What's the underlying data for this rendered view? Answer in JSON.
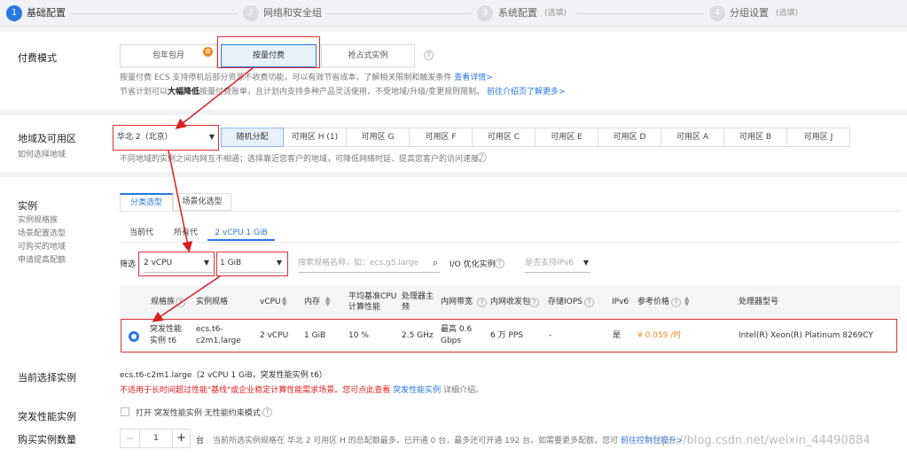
{
  "steps": [
    {
      "num": "1",
      "label": "基础配置",
      "optional": ""
    },
    {
      "num": "2",
      "label": "网络和安全组",
      "optional": ""
    },
    {
      "num": "3",
      "label": "系统配置",
      "optional": "(选填)"
    },
    {
      "num": "4",
      "label": "分组设置",
      "optional": "(选填)"
    }
  ],
  "billing": {
    "title": "付费模式",
    "options": [
      "包年包月",
      "按量付费",
      "抢占式实例"
    ],
    "selected": "按量付费",
    "desc1": "按量付费 ECS 支持停机后部分资源不收费功能，可以有效节省成本，了解相关限制和触发条件",
    "desc1_link": "查看详情>",
    "desc2_pre": "节省计划可以",
    "desc2_bold": "大幅降低",
    "desc2_post": "按量付费账单，且计划内支持多种产品灵活使用，不受地域/升级/变更规则限制。",
    "desc2_link": "前往介绍页了解更多>"
  },
  "region": {
    "title": "地域及可用区",
    "subtitle": "如何选择地域",
    "selected_region": "华北 2（北京）",
    "zones": [
      "随机分配",
      "可用区 H (1)",
      "可用区 G",
      "可用区 F",
      "可用区 C",
      "可用区 E",
      "可用区 D",
      "可用区 A",
      "可用区 B",
      "可用区 J"
    ],
    "selected_zone": "随机分配",
    "desc": "不同地域的实例之间内网互不相通；选择靠近您客户的地域，可降低网络时延、提高您客户的访问速度。"
  },
  "instance": {
    "title": "实例",
    "links": [
      "实例规格族",
      "场景配置选型",
      "可购买的地域",
      "申请提高配额"
    ],
    "tabs": [
      "分类选型",
      "场景化选型"
    ],
    "active_tab": "分类选型",
    "subtabs": [
      "当前代",
      "所有代",
      "2 vCPU 1 GiB"
    ],
    "active_subtab": "2 vCPU 1 GiB",
    "filter_label": "筛选",
    "vcpu_value": "2 vCPU",
    "mem_value": "1 GiB",
    "search_placeholder": "搜索规格名称，如：ecs.g5.large",
    "io_label": "I/O 优化实例",
    "ipv6_value": "是否支持IPv6",
    "columns": [
      "规格族",
      "实例规格",
      "vCPU",
      "内存",
      "平均基准CPU计算性能",
      "处理器主频",
      "内网带宽",
      "内网收发包",
      "存储IOPS",
      "IPv6",
      "参考价格",
      "处理器型号"
    ],
    "row": {
      "family": "突发性能实例 t6",
      "spec": "ecs.t6-c2m1.large",
      "vcpu": "2 vCPU",
      "mem": "1 GiB",
      "perf": "10 %",
      "freq": "2.5 GHz",
      "bandwidth": "最高 0.6 Gbps",
      "pps": "6 万 PPS",
      "iops": "-",
      "ipv6": "是",
      "price": "¥ 0.059 /时",
      "cpu": "Intel(R) Xeon(R) Platinum 8269CY"
    }
  },
  "current": {
    "title": "当前选择实例",
    "value": "ecs.t6-c2m1.large（2 vCPU 1 GiB，突发性能实例 t6）",
    "warning": "不适用于长时间超过性能\"基线\"或企业稳定计算性能需求场景。您可点此查看",
    "warning_link": "突发性能实例",
    "warning_post": "详细介绍。"
  },
  "burst": {
    "title": "突发性能实例",
    "checkbox_label": "打开 突发性能实例 无性能约束模式"
  },
  "quantity": {
    "title": "购买实例数量",
    "value": "1",
    "unit": "台",
    "desc": "当前所选实例规格在 华北 2 可用区 H 的总配额最多，已开通 0 台，最多还可开通 192 台。如需要更多配额，您可",
    "desc_link": "前往控制台提升>"
  },
  "watermark": "https://blog.csdn.net/weixin_44490884"
}
